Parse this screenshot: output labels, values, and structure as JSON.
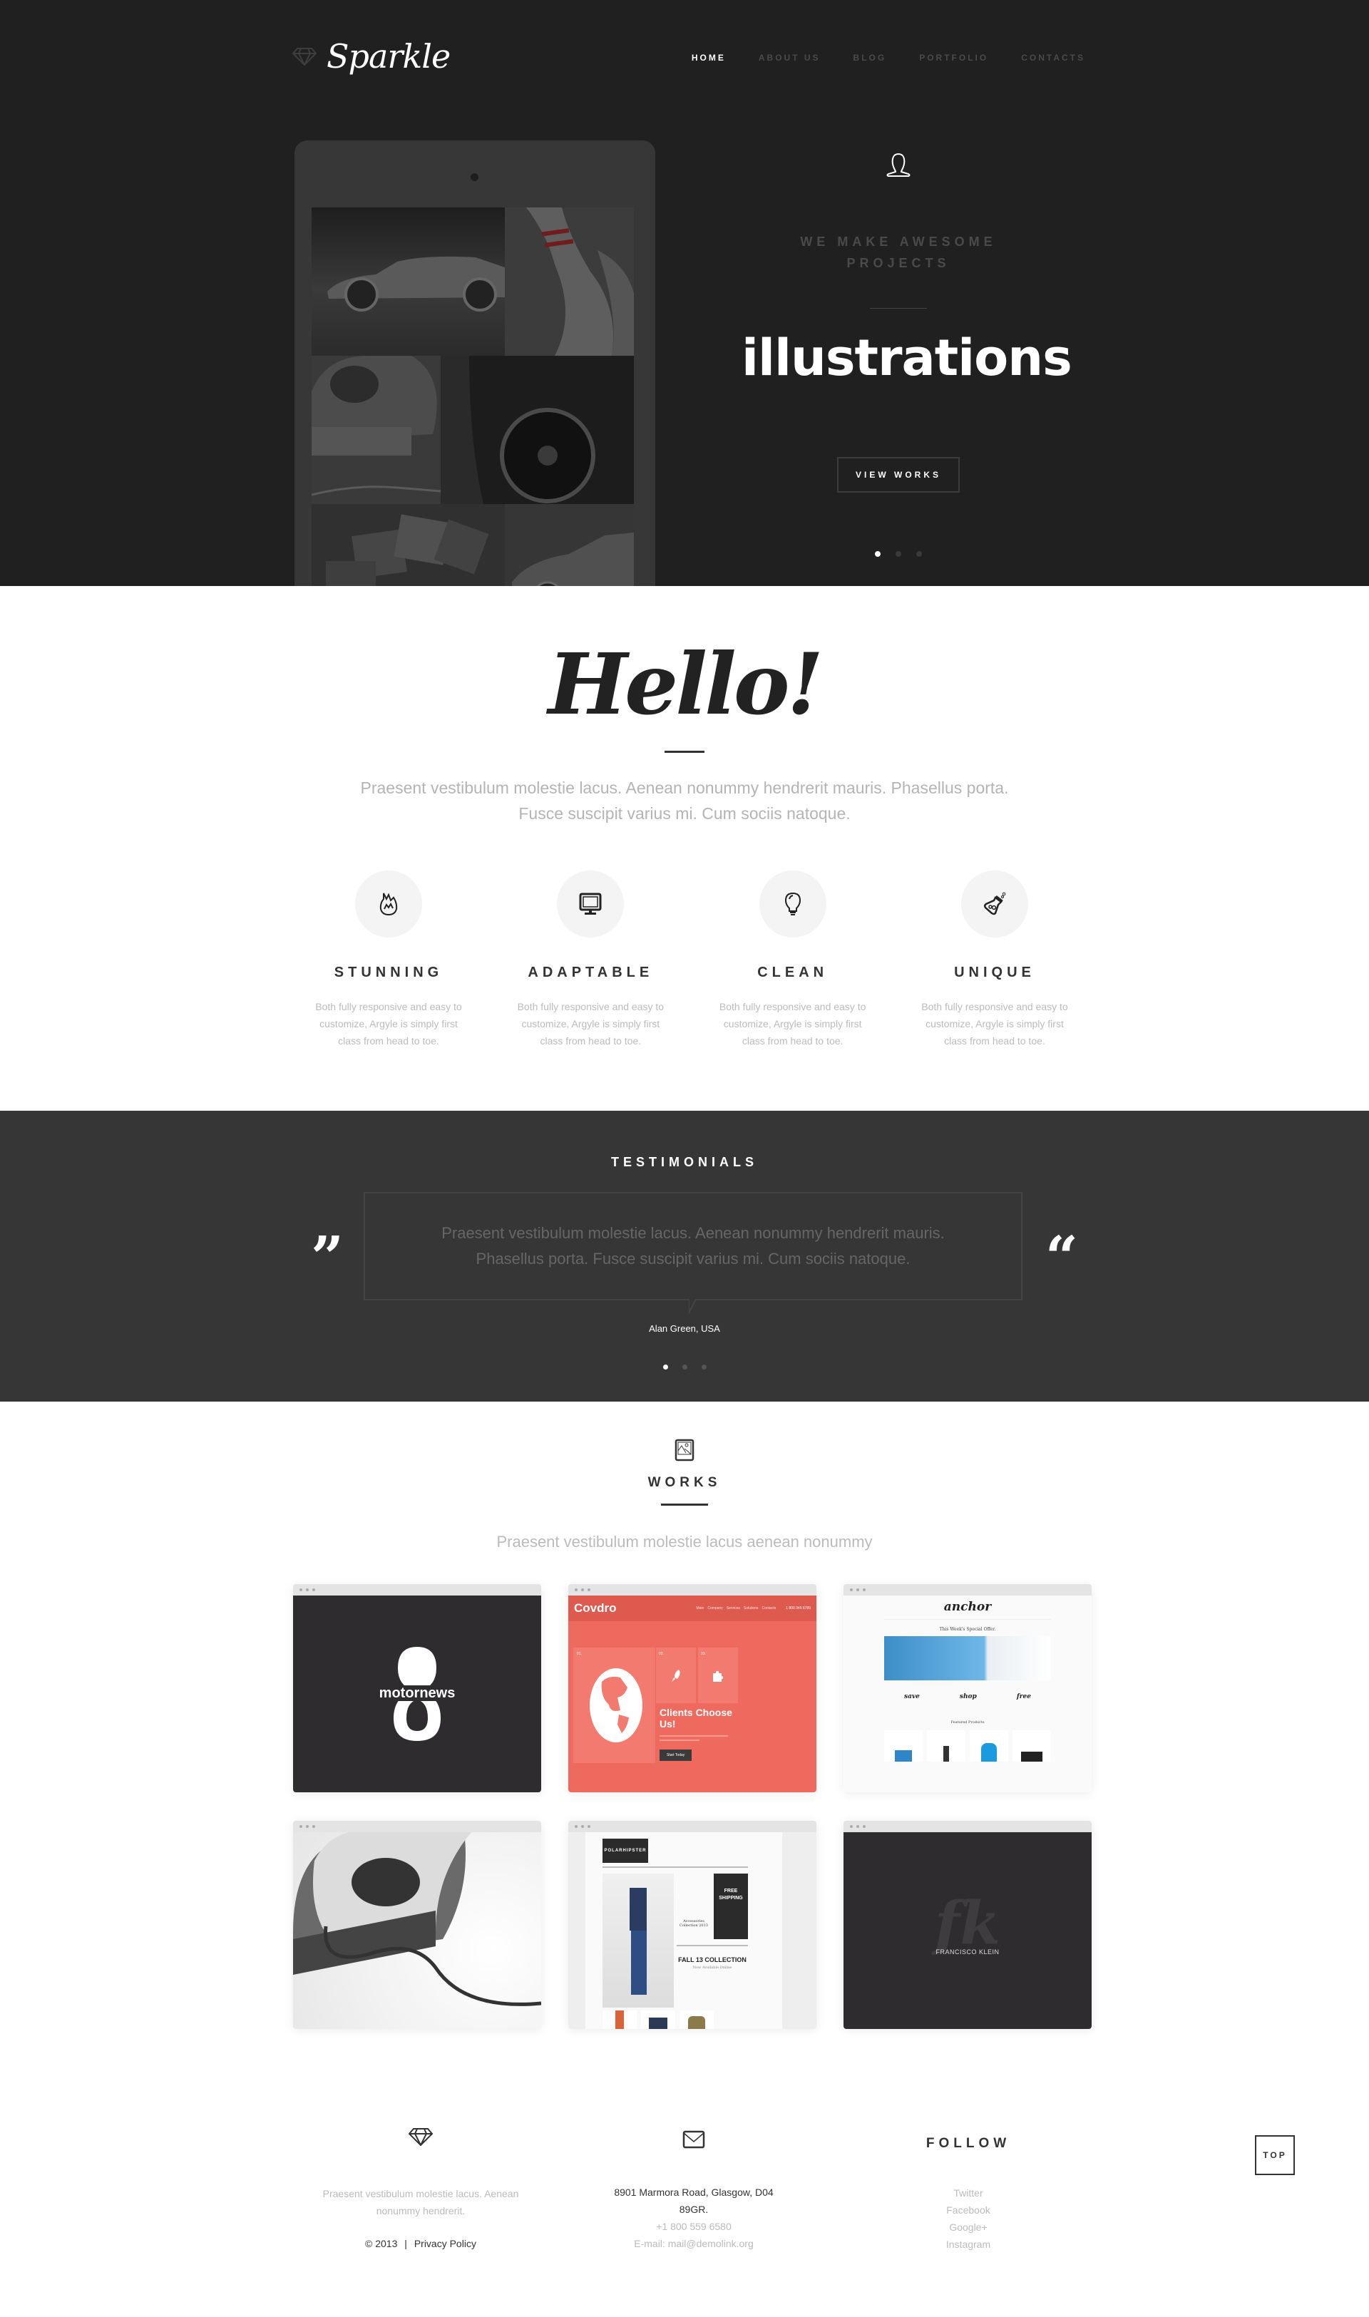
{
  "header": {
    "logo_text": "Sparkle",
    "nav": [
      {
        "label": "HOME",
        "active": true
      },
      {
        "label": "ABOUT US",
        "active": false
      },
      {
        "label": "BLOG",
        "active": false
      },
      {
        "label": "PORTFOLIO",
        "active": false
      },
      {
        "label": "CONTACTS",
        "active": false
      }
    ]
  },
  "hero": {
    "icon": "user-icon",
    "kicker": "WE MAKE AWESOME PROJECTS",
    "title": "illustrations",
    "button_label": "VIEW WORKS",
    "slide_count": 3,
    "active_slide": 1,
    "tablet_tiles": [
      "hatchback-car",
      "bowling-pins",
      "at-sign-3d",
      "sports-car-wheel",
      "3d-cubes",
      "coupe-car"
    ]
  },
  "hello": {
    "title": "Hello!",
    "text": "Praesent vestibulum molestie lacus. Aenean nonummy hendrerit mauris. Phasellus porta. Fusce suscipit varius mi. Cum sociis natoque.",
    "features": [
      {
        "icon": "fire-icon",
        "title": "STUNNING",
        "text": "Both fully responsive and easy to customize, Argyle is simply first class from head to toe."
      },
      {
        "icon": "monitor-icon",
        "title": "ADAPTABLE",
        "text": "Both fully responsive and easy to customize, Argyle is simply first class from head to toe."
      },
      {
        "icon": "lightbulb-icon",
        "title": "CLEAN",
        "text": "Both fully responsive and easy to customize, Argyle is simply first class from head to toe."
      },
      {
        "icon": "flask-icon",
        "title": "UNIQUE",
        "text": "Both fully responsive and easy to customize, Argyle is simply first class from head to toe."
      }
    ]
  },
  "testimonials": {
    "title": "TESTIMONIALS",
    "quote": "Praesent vestibulum molestie lacus. Aenean nonummy hendrerit mauris. Phasellus porta. Fusce suscipit varius mi. Cum sociis natoque.",
    "author": "Alan Green, USA",
    "slide_count": 3,
    "active_slide": 1
  },
  "works": {
    "icon": "image-icon",
    "title": "WORKS",
    "subtitle": "Praesent vestibulum molestie lacus aenean nonummy",
    "items": [
      {
        "name": "motornews",
        "label": "motornews",
        "bg": "#2e2c2f"
      },
      {
        "name": "covdro",
        "label": "Covdro",
        "bg": "#ef6a5e",
        "nav": [
          "Main",
          "Company",
          "Services",
          "Solutions",
          "Contacts"
        ],
        "phone": "1 800 345 6789",
        "numbers": [
          "01.",
          "02.",
          "03."
        ],
        "headline": "Clients Choose Us!",
        "cta": "Start Today"
      },
      {
        "name": "anchor",
        "label": "anchor",
        "bg": "#fafafa",
        "tagline": "This Week's Special Offer.",
        "pillars": [
          "save",
          "shop",
          "free"
        ],
        "section": "Featured Products"
      },
      {
        "name": "at-sign",
        "label": "@",
        "bg": "#f2f2f2"
      },
      {
        "name": "polarhipster",
        "label": "POLARHIPSTER",
        "bg": "#eeeeee",
        "promo1": "Accessories Collection 2013",
        "promo2": "FREE SHIPPING",
        "promo3": "FALL 13 COLLECTION",
        "promo3_sub": "Now Available Online"
      },
      {
        "name": "francisco-klein",
        "label": "FRANCISCO KLEIN",
        "monogram": "fk",
        "bg": "#2e2c2f"
      }
    ]
  },
  "footer": {
    "about": "Praesent vestibulum molestie lacus. Aenean nonummy hendrerit.",
    "copyright": "© 2013",
    "separator": "|",
    "privacy": "Privacy Policy",
    "address": "8901 Marmora Road, Glasgow, D04 89GR.",
    "phone": "+1 800 559 6580",
    "email": "E-mail: mail@demolink.org",
    "follow_title": "FOLLOW",
    "social": [
      "Twitter",
      "Facebook",
      "Google+",
      "Instagram"
    ],
    "top_label": "TOP"
  },
  "colors": {
    "hero_bg": "#202020",
    "testimonials_bg": "#363636",
    "accent_coral": "#ef6a5e",
    "muted_text": "#bbbbbb",
    "dark_text": "#333333"
  }
}
